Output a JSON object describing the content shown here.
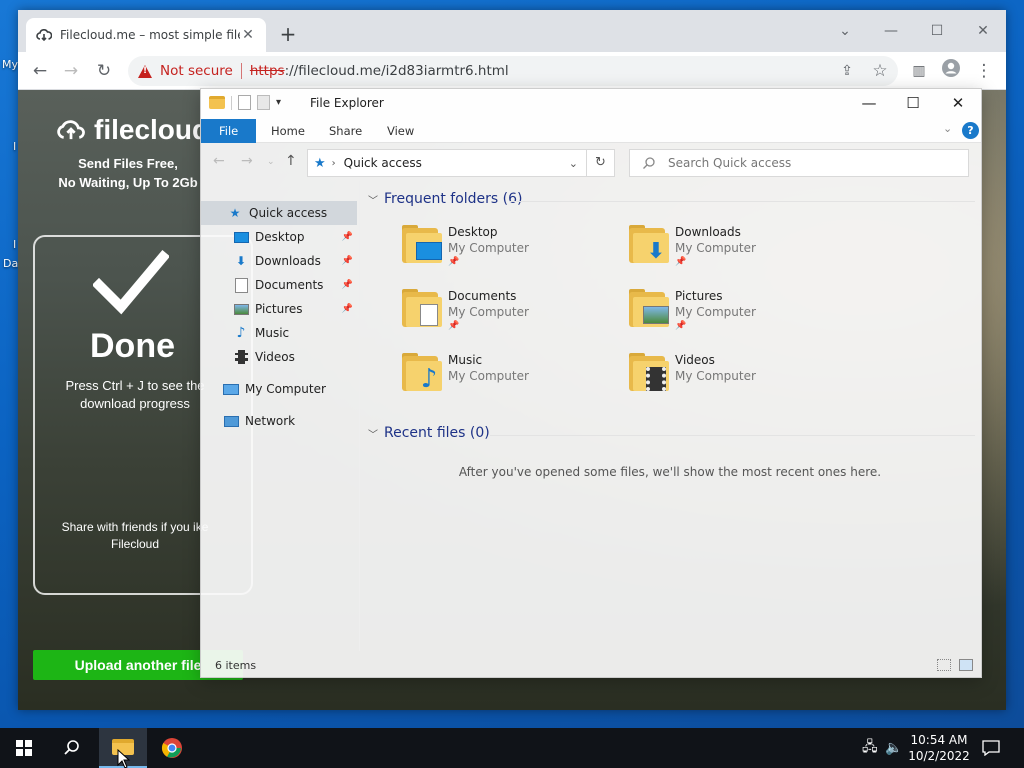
{
  "desktop": {
    "fragments": [
      "My",
      "I",
      "I",
      "Da"
    ]
  },
  "browser": {
    "tab_title": "Filecloud.me – most simple file sh",
    "new_tab": "+",
    "security_label": "Not secure",
    "url_protocol": "https",
    "url_rest": "://filecloud.me/i2d83iarmtr6.html"
  },
  "filecloud": {
    "logo": "filecloud",
    "tagline_1": "Send Files Free,",
    "tagline_2": "No Waiting, Up To 2Gb",
    "done": "Done",
    "done_sub": "Press Ctrl + J to see the download progress",
    "share": "Share with friends if you ike Filecloud",
    "upload_button": "Upload another file",
    "accent": "#1db515"
  },
  "explorer": {
    "title": "File Explorer",
    "ribbon_tabs": [
      "File",
      "Home",
      "Share",
      "View"
    ],
    "address": "Quick access",
    "search_placeholder": "Search Quick access",
    "nav": [
      {
        "label": "Quick access",
        "icon": "star-icon",
        "pinned": false
      },
      {
        "label": "Desktop",
        "icon": "desktop-icon",
        "pinned": true
      },
      {
        "label": "Downloads",
        "icon": "download-icon",
        "pinned": true
      },
      {
        "label": "Documents",
        "icon": "documents-icon",
        "pinned": true
      },
      {
        "label": "Pictures",
        "icon": "pictures-icon",
        "pinned": true
      },
      {
        "label": "Music",
        "icon": "music-icon",
        "pinned": false
      },
      {
        "label": "Videos",
        "icon": "videos-icon",
        "pinned": false
      },
      {
        "label": "My Computer",
        "icon": "computer-icon",
        "pinned": false
      },
      {
        "label": "Network",
        "icon": "network-icon",
        "pinned": false
      }
    ],
    "frequent_header": "Frequent folders (6)",
    "folders": [
      {
        "name": "Desktop",
        "location": "My Computer",
        "pinned": true,
        "icon": "desktop-folder-icon"
      },
      {
        "name": "Downloads",
        "location": "My Computer",
        "pinned": true,
        "icon": "downloads-folder-icon"
      },
      {
        "name": "Documents",
        "location": "My Computer",
        "pinned": true,
        "icon": "documents-folder-icon"
      },
      {
        "name": "Pictures",
        "location": "My Computer",
        "pinned": true,
        "icon": "pictures-folder-icon"
      },
      {
        "name": "Music",
        "location": "My Computer",
        "pinned": false,
        "icon": "music-folder-icon"
      },
      {
        "name": "Videos",
        "location": "My Computer",
        "pinned": false,
        "icon": "videos-folder-icon"
      }
    ],
    "recent_header": "Recent files (0)",
    "recent_empty": "After you've opened some files, we'll show the most recent ones here.",
    "status": "6 items",
    "accent": "#1979ca"
  },
  "taskbar": {
    "time": "10:54 AM",
    "date": "10/2/2022"
  }
}
